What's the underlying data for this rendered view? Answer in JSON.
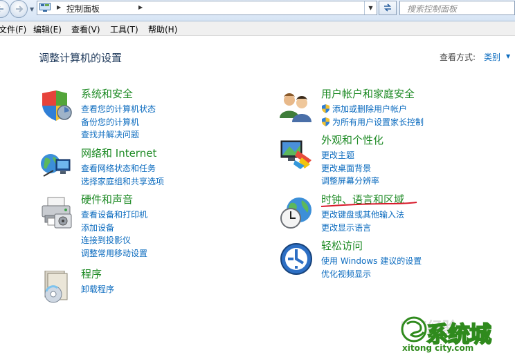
{
  "address_bar": {
    "breadcrumb": "控制面板",
    "search_placeholder": "搜索控制面板"
  },
  "menu": [
    "文件(F)",
    "编辑(E)",
    "查看(V)",
    "工具(T)",
    "帮助(H)"
  ],
  "page_title": "调整计算机的设置",
  "view_by": {
    "label": "查看方式:",
    "value": "类别"
  },
  "categories": [
    {
      "title": "系统和安全",
      "links": [
        "查看您的计算机状态",
        "备份您的计算机",
        "查找并解决问题"
      ],
      "icon": "system-security-shield-icon"
    },
    {
      "title": "网络和 Internet",
      "links": [
        "查看网络状态和任务",
        "选择家庭组和共享选项"
      ],
      "icon": "network-globe-icon"
    },
    {
      "title": "硬件和声音",
      "links": [
        "查看设备和打印机",
        "添加设备",
        "连接到投影仪",
        "调整常用移动设置"
      ],
      "icon": "printer-icon"
    },
    {
      "title": "程序",
      "links": [
        "卸载程序"
      ],
      "icon": "programs-disk-icon"
    },
    {
      "title": "用户帐户和家庭安全",
      "links": [
        "添加或删除用户帐户",
        "为所有用户设置家长控制"
      ],
      "icon": "users-icon"
    },
    {
      "title": "外观和个性化",
      "links": [
        "更改主题",
        "更改桌面背景",
        "调整屏幕分辨率"
      ],
      "icon": "appearance-monitor-icon"
    },
    {
      "title": "时钟、语言和区域",
      "links": [
        "更改键盘或其他输入法",
        "更改显示语言"
      ],
      "icon": "clock-globe-icon"
    },
    {
      "title": "轻松访问",
      "links": [
        "使用 Windows 建议的设置",
        "优化视频显示"
      ],
      "icon": "ease-of-access-icon"
    }
  ],
  "watermark": {
    "logo_text": "系统城",
    "logo_url": "xitong city.com",
    "faint_text": "Bai经验"
  },
  "colors": {
    "title_green": "#1d8a24",
    "link_blue": "#0b6bbf",
    "annotation_red": "#d8192a"
  }
}
